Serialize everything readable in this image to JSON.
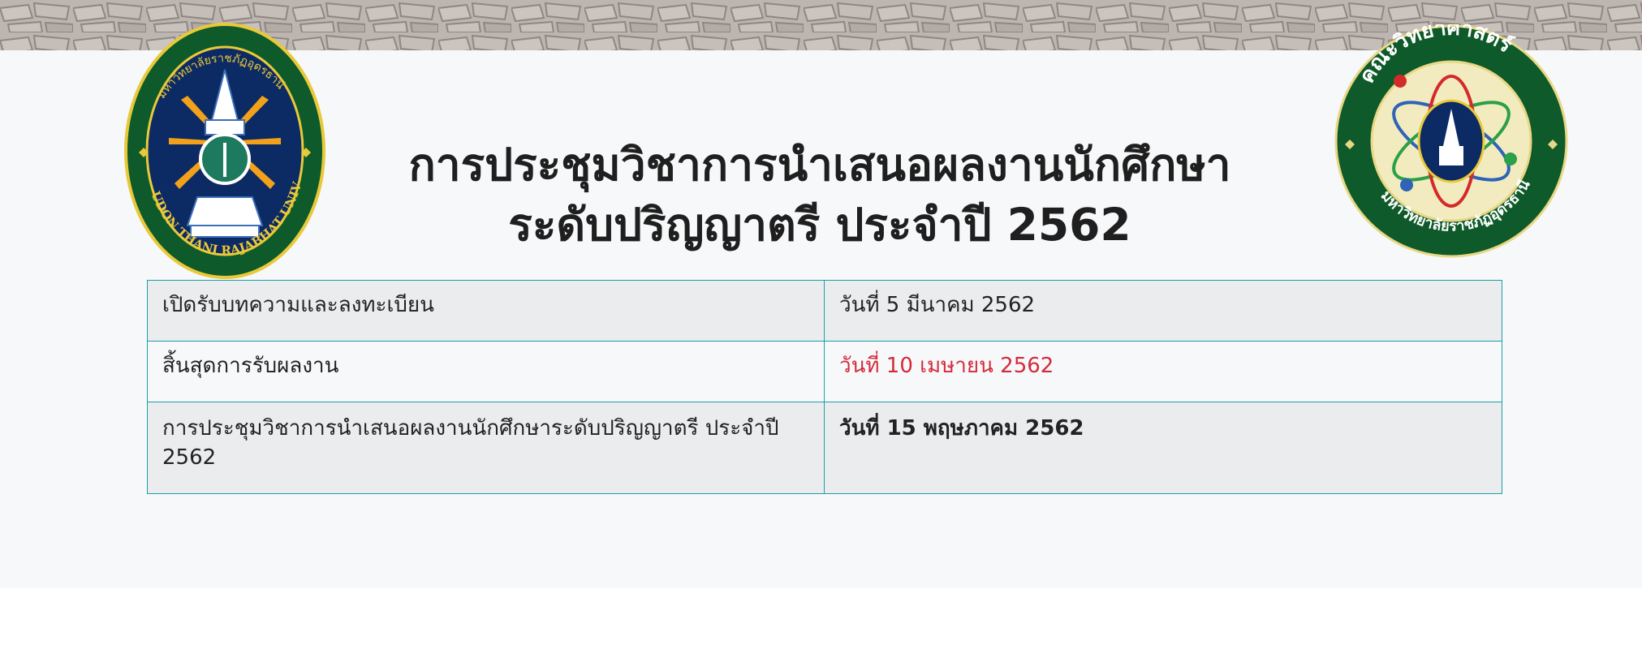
{
  "banner": {
    "description_icon": "paving-stone-texture"
  },
  "logos": {
    "left": {
      "icon": "udon-thani-rajabhat-university-seal",
      "ring_text": "UDON THANI RAJABHAT UNIVERSITY"
    },
    "right": {
      "icon": "faculty-of-science-emblem"
    }
  },
  "title": {
    "line1": "การประชุมวิชาการนำเสนอผลงานนักศึกษา",
    "line2": "ระดับปริญญาตรี ประจำปี 2562"
  },
  "schedule": {
    "rows": [
      {
        "label": "เปิดรับบทความและลงทะเบียน",
        "date": "วันที่ 5 มีนาคม 2562"
      },
      {
        "label": "สิ้นสุดการรับผลงาน",
        "date": "วันที่ 10 เมษายน 2562"
      },
      {
        "label": "การประชุมวิชาการนำเสนอผลงานนักศึกษาระดับปริญญาตรี ประจำปี 2562",
        "date": "วันที่ 15 พฤษภาคม 2562"
      }
    ],
    "colors": {
      "border": "#1aa0a8",
      "highlight": "#d42a3c"
    }
  }
}
